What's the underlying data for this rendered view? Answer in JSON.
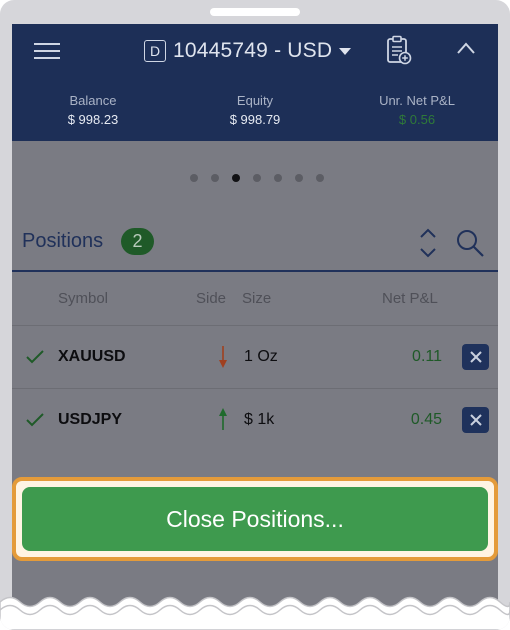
{
  "header": {
    "account_badge": "D",
    "account_text": "10445749 - USD",
    "stats": [
      {
        "label": "Balance",
        "value": "$ 998.23"
      },
      {
        "label": "Equity",
        "value": "$ 998.79"
      },
      {
        "label": "Unr. Net P&L",
        "value": "$ 0.56"
      }
    ]
  },
  "pager": {
    "total": 7,
    "active_index": 2
  },
  "positions": {
    "title": "Positions",
    "count": "2",
    "columns": {
      "symbol": "Symbol",
      "side": "Side",
      "size": "Size",
      "pnl": "Net P&L"
    },
    "rows": [
      {
        "symbol": "XAUUSD",
        "side": "sell",
        "size": "1 Oz",
        "pnl": "0.11"
      },
      {
        "symbol": "USDJPY",
        "side": "buy",
        "size": "$ 1k",
        "pnl": "0.45"
      }
    ]
  },
  "actions": {
    "close_positions_label": "Close Positions..."
  },
  "colors": {
    "header_bg": "#1d2f57",
    "positive": "#1f5a28",
    "sell_arrow": "#a0401f",
    "buy_arrow": "#1f6a2c",
    "button_green": "#3e9a4e",
    "highlight_orange": "#e49b3a"
  },
  "icons": {
    "menu": "hamburger-menu-icon",
    "report": "clipboard-add-icon",
    "collapse": "chevron-up-icon",
    "sort": "sort-icon",
    "search": "search-icon",
    "close": "close-icon"
  }
}
